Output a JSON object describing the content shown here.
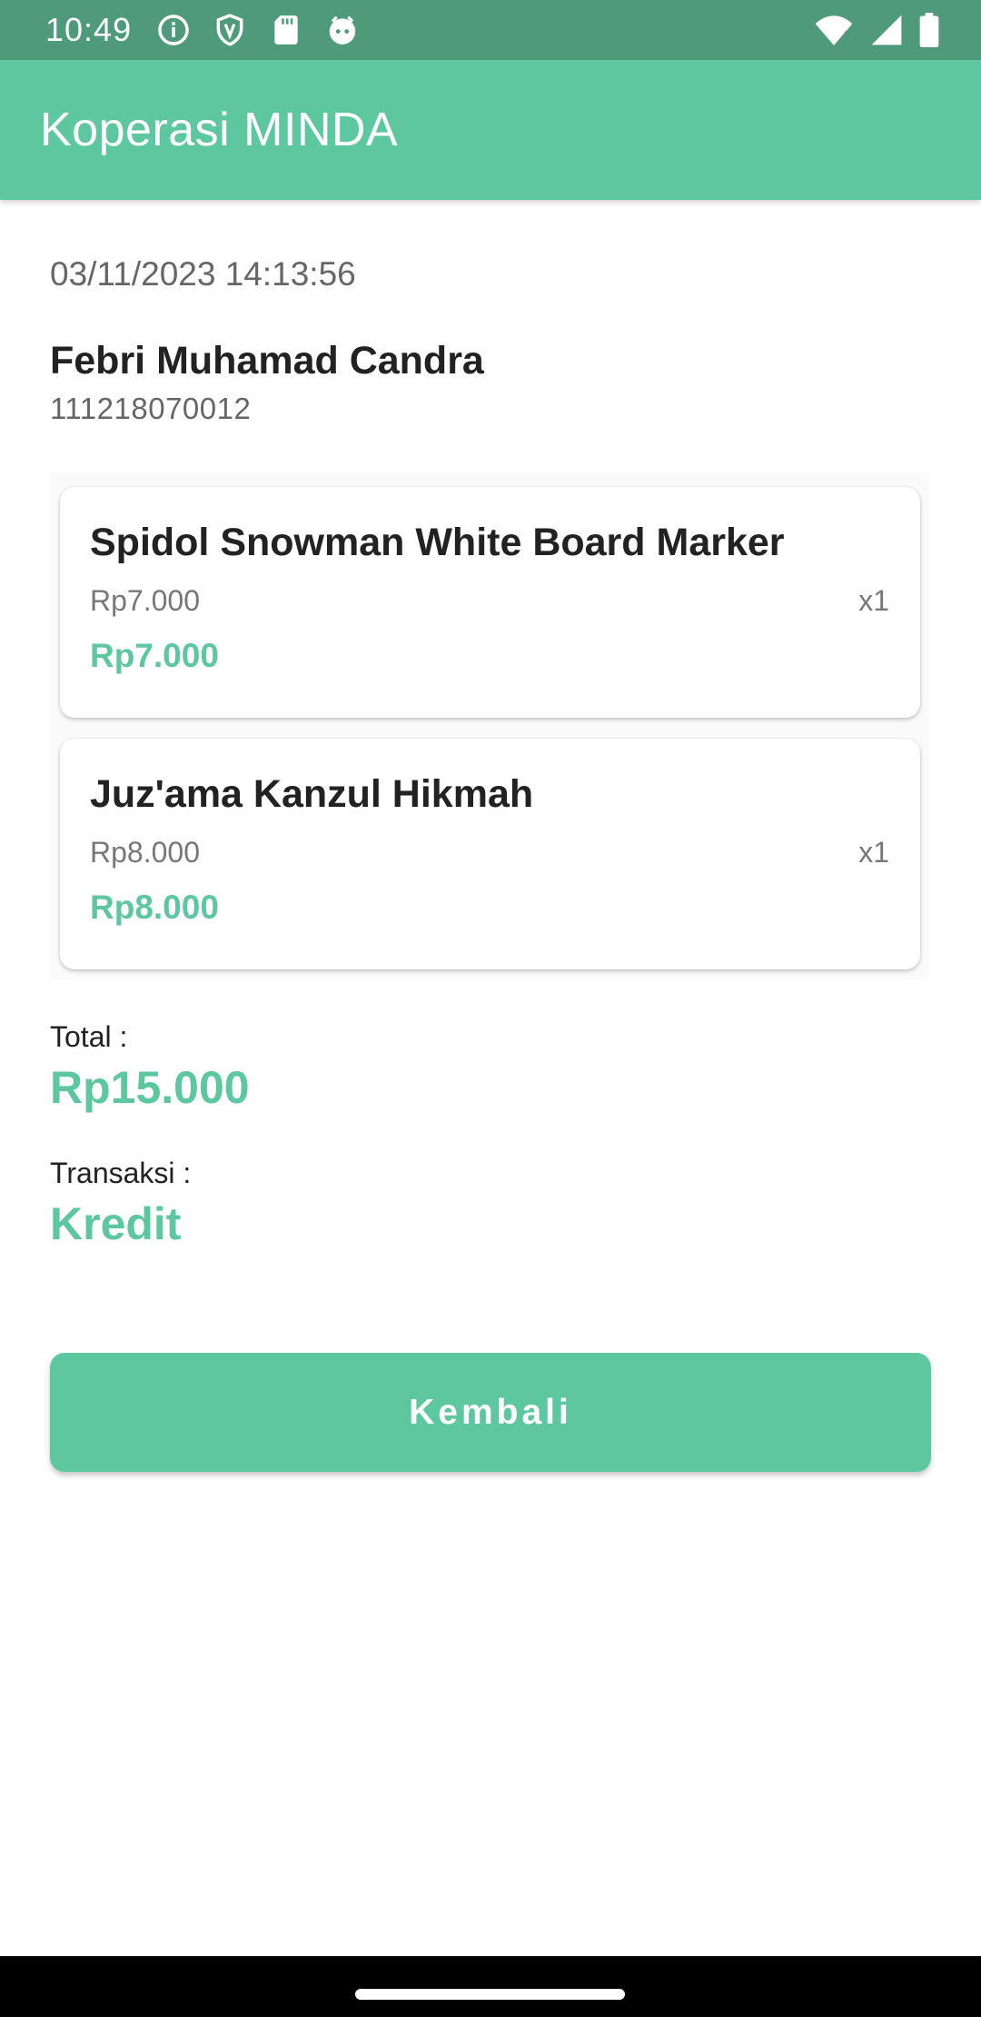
{
  "status_bar": {
    "time": "10:49",
    "left_icons": [
      "info-icon",
      "shield-icon",
      "sd-card-icon",
      "face-icon"
    ],
    "right_icons": [
      "wifi-icon",
      "signal-icon",
      "battery-icon"
    ]
  },
  "app_bar": {
    "title": "Koperasi MINDA"
  },
  "transaction": {
    "datetime": "03/11/2023 14:13:56",
    "member_name": "Febri Muhamad Candra",
    "member_id": "111218070012"
  },
  "items": [
    {
      "name": "Spidol Snowman White Board Marker",
      "price": "Rp7.000",
      "qty": "x1",
      "subtotal": "Rp7.000"
    },
    {
      "name": "Juz'ama Kanzul Hikmah",
      "price": "Rp8.000",
      "qty": "x1",
      "subtotal": "Rp8.000"
    }
  ],
  "summary": {
    "total_label": "Total :",
    "total_value": "Rp15.000",
    "transaction_label": "Transaksi :",
    "transaction_value": "Kredit"
  },
  "actions": {
    "back_label": "Kembali"
  },
  "colors": {
    "status_bar": "#4f9a7a",
    "primary": "#5dc79f",
    "text_dark": "#222222",
    "text_muted": "#666666"
  }
}
